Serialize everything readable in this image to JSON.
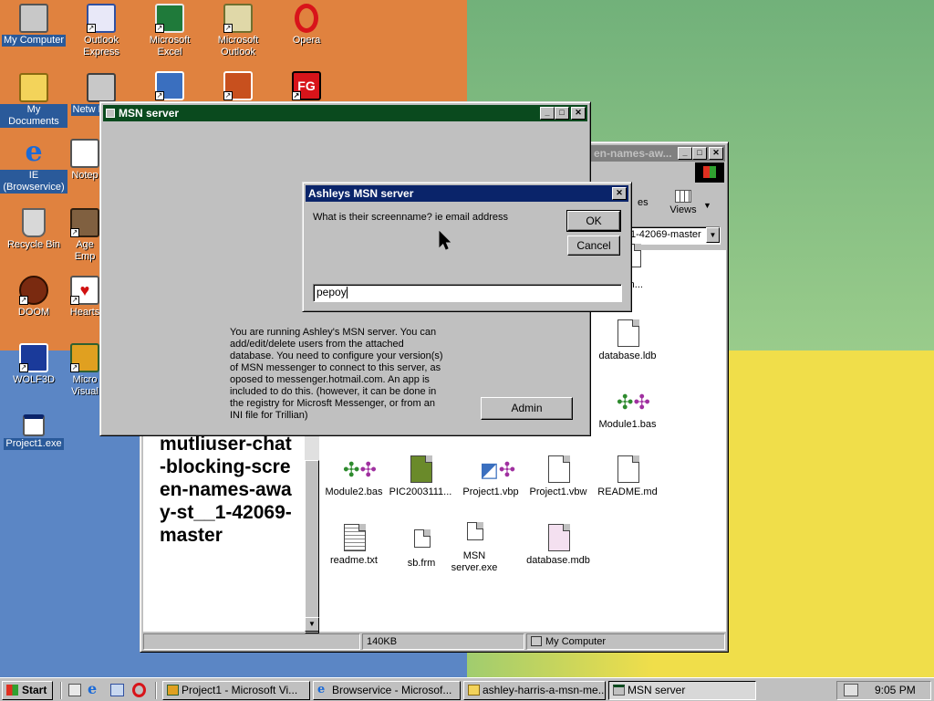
{
  "desktop": {
    "icons": [
      {
        "label": "My Computer"
      },
      {
        "label": "Outlook Express"
      },
      {
        "label": "Microsoft Excel"
      },
      {
        "label": "Microsoft Outlook"
      },
      {
        "label": "Opera"
      },
      {
        "label": "My Documents"
      },
      {
        "label": "Netw Neighb"
      },
      {
        "label": "IE (Browservice)"
      },
      {
        "label": "Notep"
      },
      {
        "label": "Recycle Bin"
      },
      {
        "label": "Age Emp"
      },
      {
        "label": "DOOM"
      },
      {
        "label": "Hearts"
      },
      {
        "label": "WOLF3D"
      },
      {
        "label": "Micro Visual"
      },
      {
        "label": "Project1.exe"
      }
    ],
    "icon_fragment_fg": "FG"
  },
  "msn_window": {
    "title": "MSN server",
    "description": "You are running Ashley's MSN server. You can add/edit/delete users from the attached database. You need to configure your version(s) of MSN messenger to connect to this server, as oposed to messenger.hotmail.com. An app is included to do this. (however, it can be done in the registry for Microsft Messenger, or from an INI file for Trillian)",
    "admin_label": "Admin"
  },
  "dialog": {
    "title": "Ashleys MSN server",
    "prompt": "What is their screenname? ie email address",
    "ok_label": "OK",
    "cancel_label": "Cancel",
    "input_value": "pepoy",
    "close_glyph": "✕"
  },
  "explorer": {
    "title_fragment": "en-names-aw...",
    "views_label": "Views",
    "toolbar_fragment": "es",
    "address_fragment": "1-42069-master",
    "folder_heading": "mutliuser-chat-blocking-screen-names-away-st__1-42069-master",
    "files": [
      {
        "label": "msn..."
      },
      {
        "label": "database.ldb"
      },
      {
        "label": "Module1.bas"
      },
      {
        "label": "Module2.bas"
      },
      {
        "label": "PIC2003111..."
      },
      {
        "label": "Project1.vbp"
      },
      {
        "label": "Project1.vbw"
      },
      {
        "label": "README.md"
      },
      {
        "label": "readme.txt"
      },
      {
        "label": "sb.frm"
      },
      {
        "label": "MSN server.exe"
      },
      {
        "label": "database.mdb"
      }
    ],
    "status_size": "140KB",
    "status_location": "My Computer"
  },
  "taskbar": {
    "start_label": "Start",
    "tasks": [
      {
        "label": "Project1 - Microsoft Vi..."
      },
      {
        "label": "Browservice - Microsof..."
      },
      {
        "label": "ashley-harris-a-msn-me..."
      },
      {
        "label": "MSN server"
      }
    ],
    "clock": "9:05 PM"
  },
  "colors": {
    "active_title": "#0a246a",
    "msn_title": "#0a4a1e",
    "face": "#c0c0c0"
  }
}
